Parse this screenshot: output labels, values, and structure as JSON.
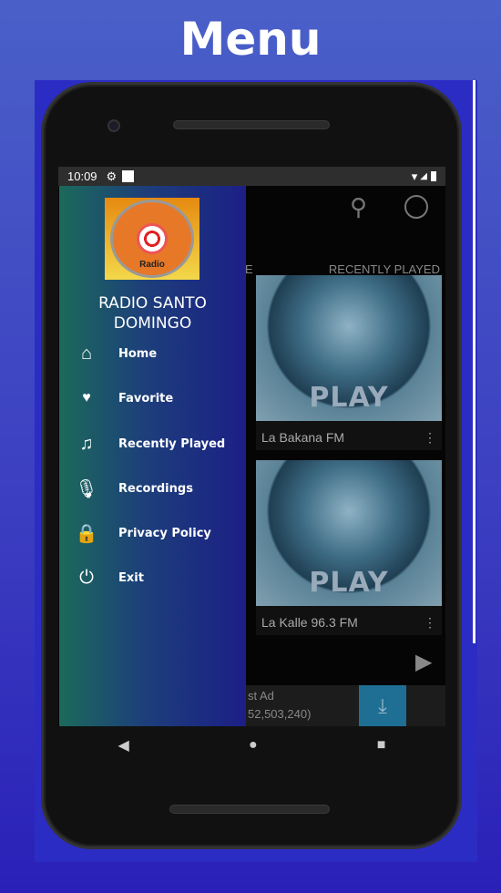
{
  "page_title": "Menu",
  "status": {
    "time": "10:09"
  },
  "app": {
    "tab_partial": "E",
    "tab_recent": "RECENTLY PLAYED",
    "stations": [
      {
        "name": "La Bakana FM",
        "art": "PLAY"
      },
      {
        "name": "La Kalle 96.3 FM",
        "art": "PLAY"
      }
    ],
    "ad": {
      "line1": "st Ad",
      "line2": "52,503,240)"
    }
  },
  "drawer": {
    "logo_text": "Radio",
    "app_name_1": "RADIO SANTO",
    "app_name_2": "DOMINGO",
    "items": [
      {
        "label": "Home",
        "icon": "home-icon"
      },
      {
        "label": "Favorite",
        "icon": "heart-icon"
      },
      {
        "label": "Recently Played",
        "icon": "music-note-icon"
      },
      {
        "label": "Recordings",
        "icon": "microphone-icon"
      },
      {
        "label": "Privacy Policy",
        "icon": "lock-icon"
      },
      {
        "label": "Exit",
        "icon": "power-icon"
      }
    ]
  },
  "colors": {
    "drawer_start": "#1b6a5a",
    "drawer_end": "#1c1f86",
    "background": "#3a3cc0"
  }
}
